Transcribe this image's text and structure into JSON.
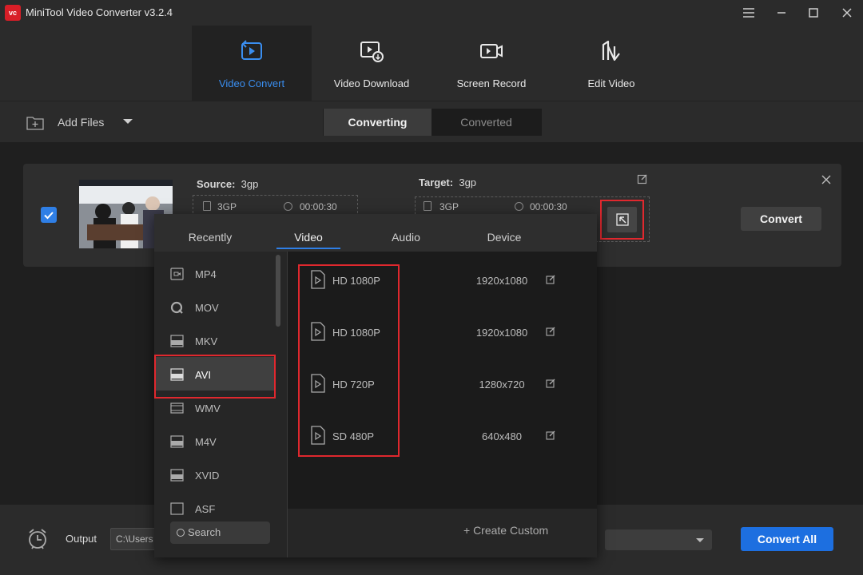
{
  "window": {
    "logo_text": "vc",
    "title": "MiniTool Video Converter v3.2.4",
    "controls": [
      "menu-icon",
      "minimize-icon",
      "maximize-icon",
      "close-icon"
    ]
  },
  "nav": {
    "items": [
      {
        "label": "Video Convert",
        "icon": "video-convert-icon",
        "active": true
      },
      {
        "label": "Video Download",
        "icon": "video-download-icon",
        "active": false
      },
      {
        "label": "Screen Record",
        "icon": "screen-record-icon",
        "active": false
      },
      {
        "label": "Edit Video",
        "icon": "edit-video-icon",
        "active": false
      }
    ]
  },
  "toolbar": {
    "add_files_label": "Add Files",
    "tabs": [
      {
        "label": "Converting",
        "active": true
      },
      {
        "label": "Converted",
        "active": false
      }
    ]
  },
  "file": {
    "checked": true,
    "source_label": "Source:",
    "source_format": "3gp",
    "source_box_format": "3GP",
    "source_duration": "00:00:30",
    "target_label": "Target:",
    "target_format": "3gp",
    "target_box_format": "3GP",
    "target_duration": "00:00:30",
    "convert_label": "Convert"
  },
  "format_popup": {
    "tabs": [
      {
        "label": "Recently",
        "active": false
      },
      {
        "label": "Video",
        "active": true
      },
      {
        "label": "Audio",
        "active": false
      },
      {
        "label": "Device",
        "active": false
      }
    ],
    "formats": [
      {
        "label": "MP4",
        "icon": "mp4-icon",
        "active": false
      },
      {
        "label": "MOV",
        "icon": "mov-icon",
        "active": false
      },
      {
        "label": "MKV",
        "icon": "mkv-icon",
        "active": false
      },
      {
        "label": "AVI",
        "icon": "avi-icon",
        "active": true
      },
      {
        "label": "WMV",
        "icon": "wmv-icon",
        "active": false
      },
      {
        "label": "M4V",
        "icon": "m4v-icon",
        "active": false
      },
      {
        "label": "XVID",
        "icon": "xvid-icon",
        "active": false
      },
      {
        "label": "ASF",
        "icon": "asf-icon",
        "active": false
      }
    ],
    "search_placeholder": "Search",
    "resolutions": [
      {
        "name": "HD 1080P",
        "resolution": "1920x1080"
      },
      {
        "name": "HD 1080P",
        "resolution": "1920x1080"
      },
      {
        "name": "HD 720P",
        "resolution": "1280x720"
      },
      {
        "name": "SD 480P",
        "resolution": "640x480"
      }
    ],
    "create_custom_label": "+ Create Custom"
  },
  "bottom": {
    "output_label": "Output",
    "output_path": "C:\\Users",
    "convert_all_label": "Convert All"
  },
  "colors": {
    "accent": "#2f7fe6",
    "highlight_border": "#e0282e",
    "convert_all_bg": "#1d6fe0"
  }
}
